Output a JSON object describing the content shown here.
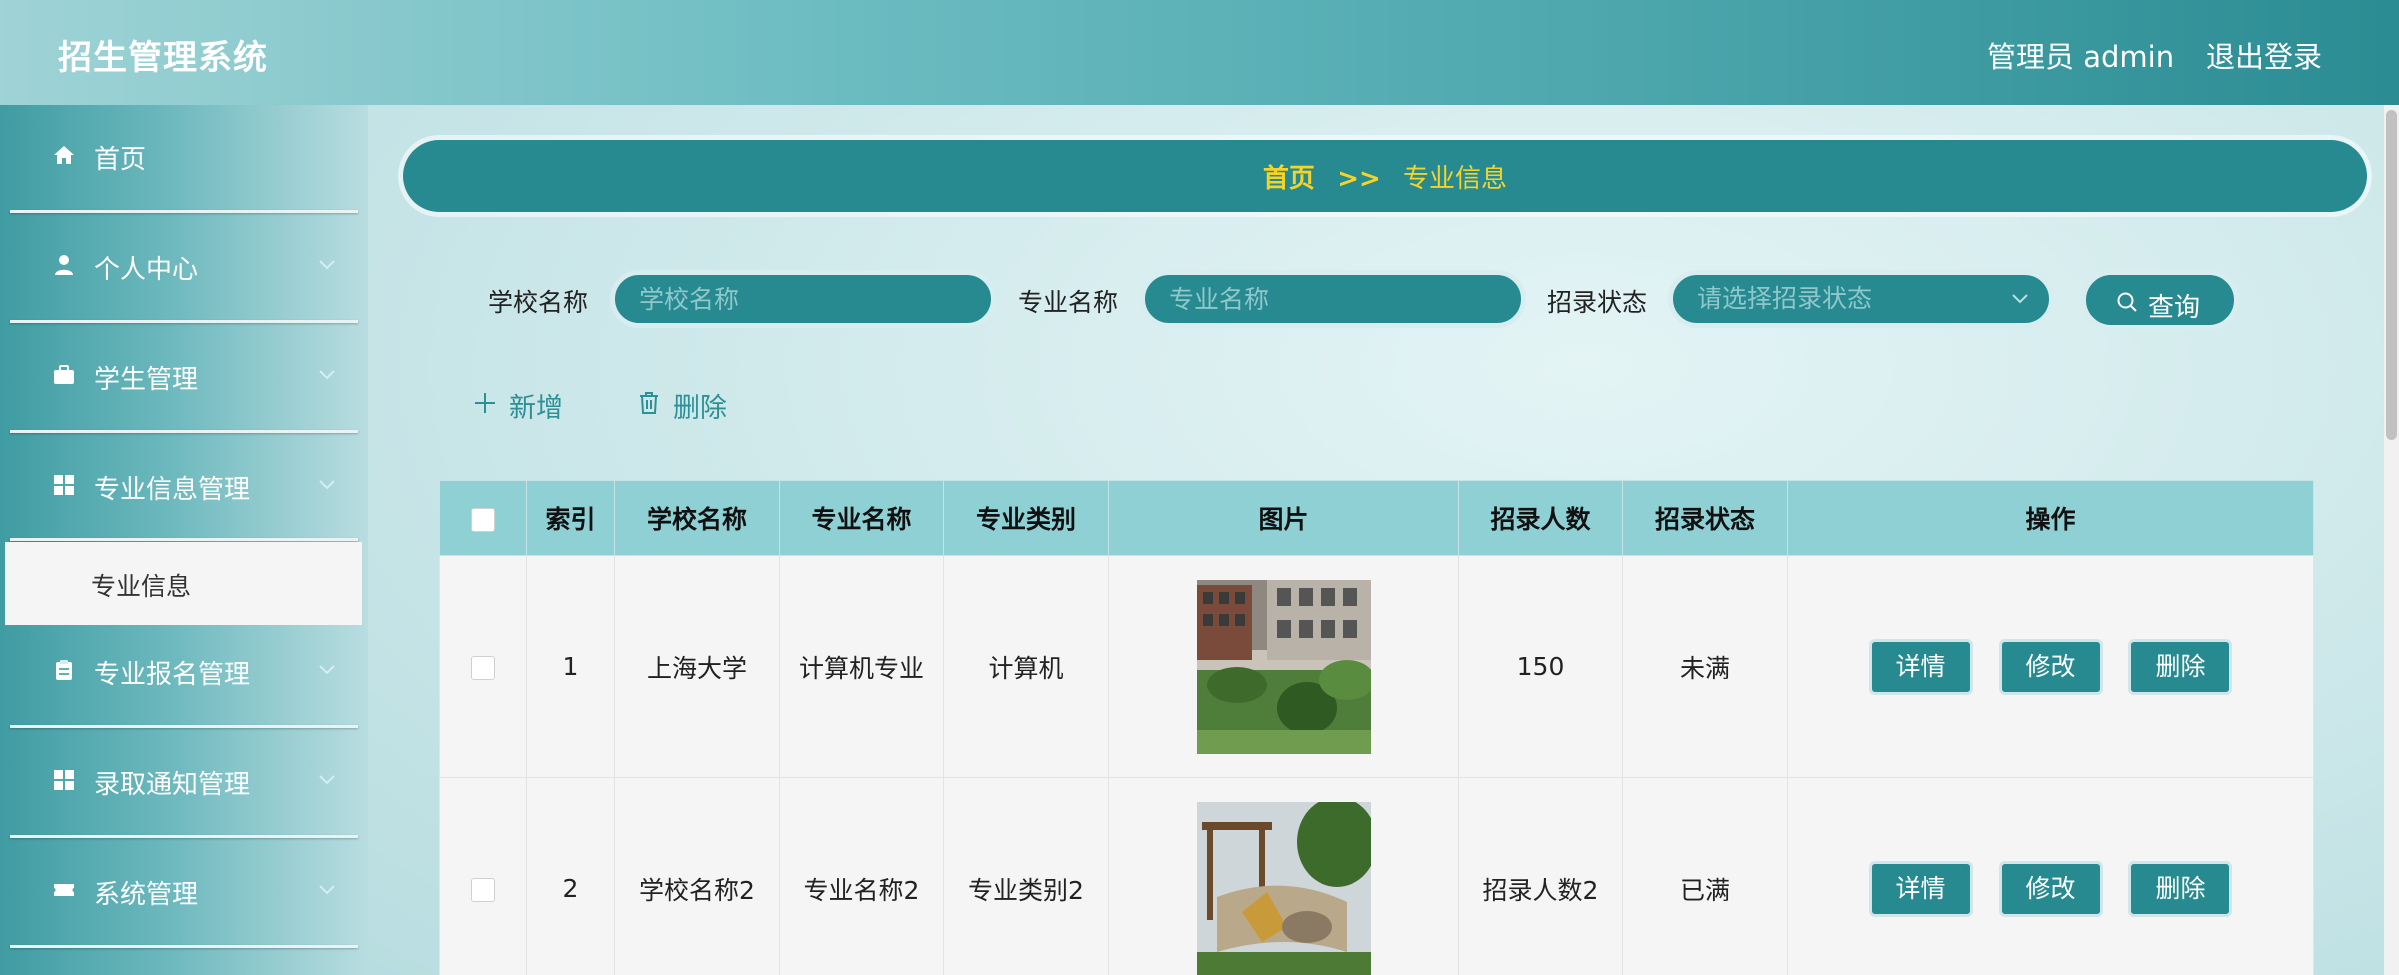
{
  "header": {
    "app_title": "招生管理系统",
    "admin_label": "管理员 admin",
    "logout_label": "退出登录"
  },
  "sidebar": {
    "items": [
      {
        "label": "首页",
        "icon": "home-icon"
      },
      {
        "label": "个人中心",
        "icon": "user-icon"
      },
      {
        "label": "学生管理",
        "icon": "briefcase-icon"
      },
      {
        "label": "专业信息管理",
        "icon": "grid-icon",
        "expanded": true
      },
      {
        "label": "专业报名管理",
        "icon": "clipboard-icon"
      },
      {
        "label": "录取通知管理",
        "icon": "grid-icon"
      },
      {
        "label": "系统管理",
        "icon": "ticket-icon"
      }
    ],
    "active_submenu": "专业信息"
  },
  "breadcrumb": {
    "home": "首页",
    "separator": ">>",
    "current": "专业信息"
  },
  "filters": {
    "school_label": "学校名称",
    "school_placeholder": "学校名称",
    "major_label": "专业名称",
    "major_placeholder": "专业名称",
    "status_label": "招录状态",
    "status_placeholder": "请选择招录状态",
    "query_label": "查询"
  },
  "actions": {
    "add_label": "新增",
    "delete_label": "删除"
  },
  "table": {
    "headers": [
      "索引",
      "学校名称",
      "专业名称",
      "专业类别",
      "图片",
      "招录人数",
      "招录状态",
      "操作"
    ],
    "rows": [
      {
        "index": "1",
        "school": "上海大学",
        "major": "计算机专业",
        "category": "计算机",
        "count": "150",
        "status": "未满"
      },
      {
        "index": "2",
        "school": "学校名称2",
        "major": "专业名称2",
        "category": "专业类别2",
        "count": "招录人数2",
        "status": "已满"
      }
    ],
    "btn_detail": "详情",
    "btn_edit": "修改",
    "btn_delete": "删除"
  },
  "colors": {
    "accent": "#268a90",
    "breadcrumb_text": "#f5d327",
    "header_row": "#8fd0d5"
  }
}
